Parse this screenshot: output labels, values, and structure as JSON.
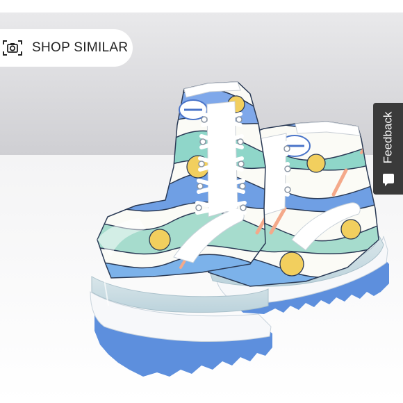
{
  "shop_similar": {
    "label": "SHOP SIMILAR",
    "icon": "camera-scan-icon"
  },
  "feedback": {
    "label": "Feedback",
    "icon": "feedback-icon"
  },
  "product_image": {
    "subject": "high-top platform sneakers with abstract wavy print",
    "colors": {
      "sky_blue": "#6fa0e6",
      "mint": "#8fd6c9",
      "yellow": "#f2cf5e",
      "peach": "#f4a98a",
      "sole_blue": "#5d8fdd",
      "background": "#d4d4d7"
    }
  }
}
